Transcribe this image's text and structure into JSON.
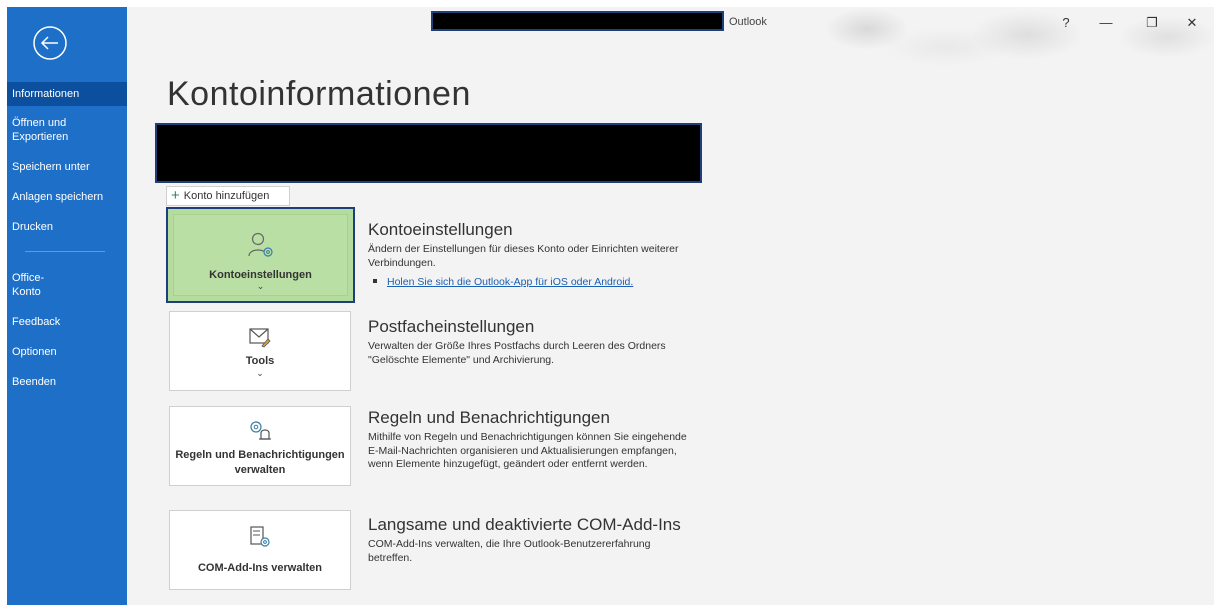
{
  "app": {
    "title": "Outlook"
  },
  "window_controls": {
    "help": "?",
    "minimize": "—",
    "restore": "❐",
    "close": "✕"
  },
  "sidebar": {
    "items": [
      {
        "label": "Informationen",
        "active": true
      },
      {
        "label": "Öffnen und\nExportieren"
      },
      {
        "label": "Speichern unter"
      },
      {
        "label": "Anlagen speichern"
      },
      {
        "label": "Drucken"
      },
      {
        "label": "Office-\nKonto"
      },
      {
        "label": "Feedback"
      },
      {
        "label": "Optionen"
      },
      {
        "label": "Beenden"
      }
    ]
  },
  "main": {
    "title": "Kontoinformationen",
    "add_account_label": "Konto hinzufügen",
    "sections": [
      {
        "tile_label": "Kontoeinstellungen",
        "tile_chevron": "⌄",
        "heading": "Kontoeinstellungen",
        "description": "Ändern der Einstellungen für dieses Konto oder Einrichten weiterer Verbindungen.",
        "link": "Holen Sie sich die Outlook-App für iOS oder Android."
      },
      {
        "tile_label": "Tools",
        "tile_chevron": "⌄",
        "heading": "Postfacheinstellungen",
        "description": "Verwalten der Größe Ihres Postfachs durch Leeren des Ordners \"Gelöschte Elemente\" und Archivierung."
      },
      {
        "tile_label": "Regeln und Benachrichtigungen verwalten",
        "heading": "Regeln und Benachrichtigungen",
        "description": "Mithilfe von Regeln und Benachrichtigungen können Sie eingehende E-Mail-Nachrichten organisieren und Aktualisierungen empfangen, wenn Elemente hinzugefügt, geändert oder entfernt werden."
      },
      {
        "tile_label": "COM-Add-Ins verwalten",
        "heading": "Langsame und deaktivierte COM-Add-Ins",
        "description": "COM-Add-Ins verwalten, die Ihre Outlook-Benutzererfahrung betreffen."
      }
    ]
  },
  "colors": {
    "sidebar": "#1e6fc7",
    "sidebar_active": "#0b4f9e",
    "tile_active": "#b4dc9e",
    "link": "#1a5fb4"
  }
}
